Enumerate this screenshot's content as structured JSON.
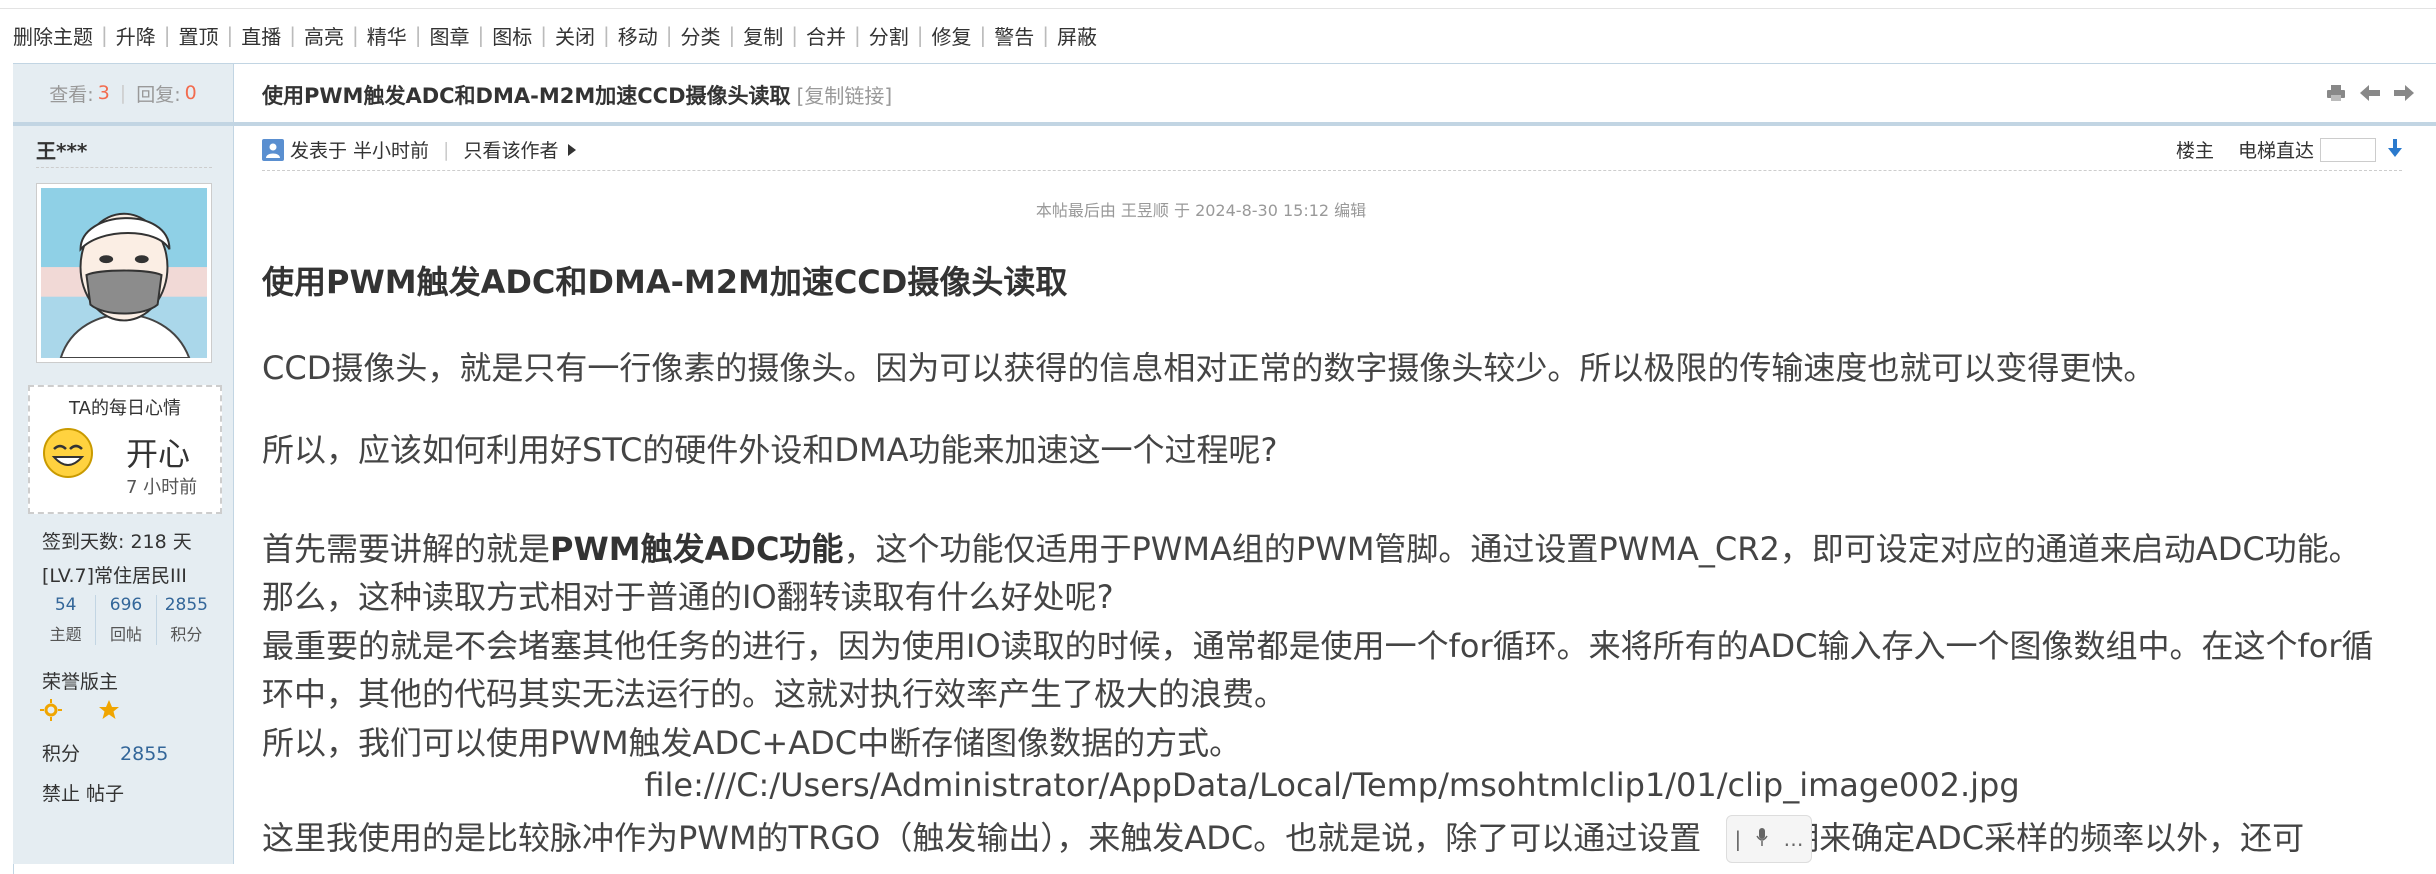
{
  "modbar": [
    "删除主题",
    "升降",
    "置顶",
    "直播",
    "高亮",
    "精华",
    "图章",
    "图标",
    "关闭",
    "移动",
    "分类",
    "复制",
    "合并",
    "分割",
    "修复",
    "警告",
    "屏蔽"
  ],
  "thread": {
    "views_label": "查看:",
    "views": "3",
    "replies_label": "回复:",
    "replies": "0",
    "title": "使用PWM触发ADC和DMA-M2M加速CCD摄像头读取",
    "copy_link": "[复制链接]"
  },
  "author": {
    "name": "王***",
    "mood_label": "TA的每日心情",
    "mood": "开心",
    "mood_time": "7 小时前",
    "signin": "签到天数: 218 天",
    "level": "[LV.7]常住居民III",
    "stats": [
      {
        "num": "54",
        "label": "主题"
      },
      {
        "num": "696",
        "label": "回帖"
      },
      {
        "num": "2855",
        "label": "积分"
      }
    ],
    "group": "荣誉版主",
    "points_label": "积分",
    "points": "2855",
    "ban": "禁止 帖子"
  },
  "post": {
    "posted": "发表于 半小时前",
    "only_author": "只看该作者",
    "floor": "楼主",
    "jump_label": "电梯直达",
    "edit_note": "本帖最后由 王昱顺 于 2024-8-30 15:12 编辑",
    "title": "使用PWM触发ADC和DMA-M2M加速CCD摄像头读取",
    "p1": "CCD摄像头，就是只有一行像素的摄像头。因为可以获得的信息相对正常的数字摄像头较少。所以极限的传输速度也就可以变得更快。",
    "p2": "所以，应该如何利用好STC的硬件外设和DMA功能来加速这一个过程呢?",
    "p3_a": "首先需要讲解的就是",
    "p3_b": "PWM触发ADC功能",
    "p3_c": "，这个功能仅适用于PWMA组的PWM管脚。通过设置PWMA_CR2，即可设定对应的通道来启动ADC功能。",
    "p4": "那么，这种读取方式相对于普通的IO翻转读取有什么好处呢?",
    "p5": "最重要的就是不会堵塞其他任务的进行，因为使用IO读取的时候，通常都是使用一个for循环。来将所有的ADC输入存入一个图像数组中。在这个for循",
    "p6": "环中，其他的代码其实无法运行的。这就对执行效率产生了极大的浪费。",
    "p7": "所以，我们可以使用PWM触发ADC+ADC中断存储图像数据的方式。",
    "img_path": "file:///C:/Users/Administrator/AppData/Local/Temp/msohtmlclip1/01/clip_image002.jpg",
    "p8_a": "这里我使用的是比较脉冲作为PWM的TRGO（触发输出），来触发ADC。也就是说，除了可以通过设置",
    "p8_b": "期来确定ADC采样的频率以外，还可"
  }
}
